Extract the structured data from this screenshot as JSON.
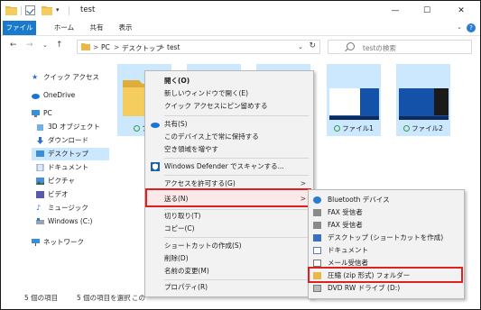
{
  "window": {
    "title": "test",
    "min_glyph": "—",
    "max_glyph": "☐",
    "close_glyph": "✕",
    "qa_down_glyph": "▾"
  },
  "ribbon": {
    "tabs": [
      "ファイル",
      "ホーム",
      "共有",
      "表示"
    ],
    "help": "?",
    "expand_glyph": "⌄"
  },
  "address": {
    "back": "←",
    "forward": "→",
    "recent": "⌄",
    "up": "↑",
    "crumb_sep": ">",
    "crumbs": [
      "PC",
      "デスクトップ",
      "test"
    ],
    "dropdown": "⌄",
    "refresh": "↻",
    "search_placeholder": "testの検索"
  },
  "nav": {
    "items": [
      {
        "label": "クイック アクセス",
        "icon": "star-icon"
      },
      {
        "label": "OneDrive",
        "icon": "cloud-icon"
      },
      {
        "label": "PC",
        "icon": "computer-icon"
      },
      {
        "label": "3D オブジェクト",
        "icon": "cube-icon"
      },
      {
        "label": "ダウンロード",
        "icon": "download-icon"
      },
      {
        "label": "デスクトップ",
        "icon": "desktop-icon"
      },
      {
        "label": "ドキュメント",
        "icon": "document-icon"
      },
      {
        "label": "ピクチャ",
        "icon": "picture-icon"
      },
      {
        "label": "ビデオ",
        "icon": "video-icon"
      },
      {
        "label": "ミュージック",
        "icon": "music-icon"
      },
      {
        "label": "Windows (C:)",
        "icon": "drive-icon"
      },
      {
        "label": "ネットワーク",
        "icon": "network-icon"
      }
    ]
  },
  "files": [
    {
      "caption": "フォ"
    },
    {
      "caption": ""
    },
    {
      "caption": ""
    },
    {
      "caption": "ファイル1"
    },
    {
      "caption": "ファイル2"
    }
  ],
  "status": {
    "count": "5 個の項目",
    "selected": "5 個の項目を選択",
    "extra": "この"
  },
  "context_menu": {
    "items": [
      {
        "label": "開く(O)",
        "bold": true
      },
      {
        "label": "新しいウィンドウで開く(E)"
      },
      {
        "label": "クイック アクセスにピン留めする"
      },
      {
        "label": "共有(S)"
      },
      {
        "label": "このデバイス上で常に保持する"
      },
      {
        "label": "空き領域を増やす"
      },
      {
        "label": "Windows Defender でスキャンする..."
      },
      {
        "label": "アクセスを許可する(G)"
      },
      {
        "label": "送る(N)"
      },
      {
        "label": "切り取り(T)"
      },
      {
        "label": "コピー(C)"
      },
      {
        "label": "ショートカットの作成(S)"
      },
      {
        "label": "削除(D)"
      },
      {
        "label": "名前の変更(M)"
      },
      {
        "label": "プロパティ(R)"
      }
    ],
    "submenu_arrow": ">"
  },
  "send_to_menu": {
    "items": [
      {
        "label": "Bluetooth デバイス",
        "icon": "bluetooth-icon"
      },
      {
        "label": "FAX 受信者",
        "icon": "fax-icon"
      },
      {
        "label": "FAX 受信者",
        "icon": "fax-icon"
      },
      {
        "label": "デスクトップ (ショートカットを作成)",
        "icon": "desktop-icon"
      },
      {
        "label": "ドキュメント",
        "icon": "document-icon"
      },
      {
        "label": "メール受信者",
        "icon": "mail-icon"
      },
      {
        "label": "圧縮 (zip 形式) フォルダー",
        "icon": "zip-folder-icon"
      },
      {
        "label": "DVD RW ドライブ (D:)",
        "icon": "dvd-drive-icon"
      }
    ]
  }
}
